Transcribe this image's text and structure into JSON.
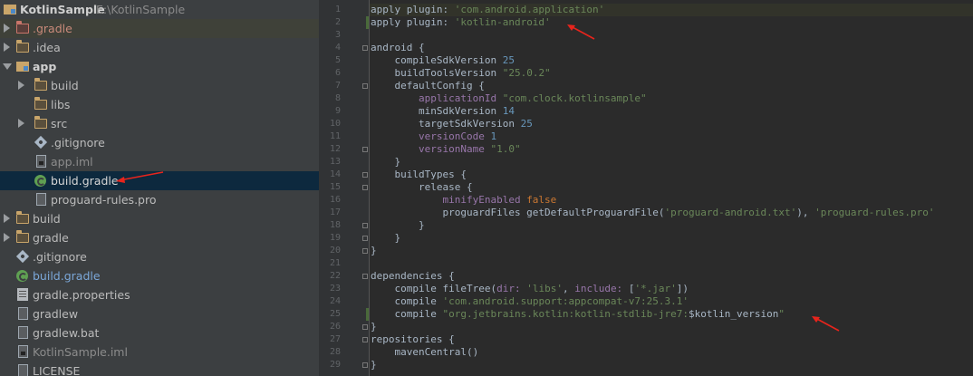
{
  "project_tree": {
    "root": {
      "name": "KotlinSample",
      "path": "E:\\KotlinSample"
    },
    "items": [
      {
        "label": ".gradle"
      },
      {
        "label": ".idea"
      },
      {
        "label": "app"
      },
      {
        "label": "build"
      },
      {
        "label": "libs"
      },
      {
        "label": "src"
      },
      {
        "label": ".gitignore"
      },
      {
        "label": "app.iml"
      },
      {
        "label": "build.gradle"
      },
      {
        "label": "proguard-rules.pro"
      },
      {
        "label": "build"
      },
      {
        "label": "gradle"
      },
      {
        "label": ".gitignore"
      },
      {
        "label": "build.gradle"
      },
      {
        "label": "gradle.properties"
      },
      {
        "label": "gradlew"
      },
      {
        "label": "gradlew.bat"
      },
      {
        "label": "KotlinSample.iml"
      },
      {
        "label": "LICENSE"
      }
    ]
  },
  "editor": {
    "line_numbers": [
      "1",
      "2",
      "3",
      "4",
      "5",
      "6",
      "7",
      "8",
      "9",
      "10",
      "11",
      "12",
      "13",
      "14",
      "15",
      "16",
      "17",
      "18",
      "19",
      "20",
      "21",
      "22",
      "23",
      "24",
      "25",
      "26",
      "27",
      "28",
      "29"
    ],
    "lines": [
      [
        {
          "t": "apply plugin: ",
          "c": "#a9b7c6"
        },
        {
          "t": "'com.android.application'",
          "c": "#6a8759"
        }
      ],
      [
        {
          "t": "apply plugin: ",
          "c": "#a9b7c6"
        },
        {
          "t": "'kotlin-android'",
          "c": "#6a8759"
        }
      ],
      [],
      [
        {
          "t": "android {",
          "c": "#a9b7c6"
        }
      ],
      [
        {
          "t": "    compileSdkVersion ",
          "c": "#a9b7c6"
        },
        {
          "t": "25",
          "c": "#6897bb"
        }
      ],
      [
        {
          "t": "    buildToolsVersion ",
          "c": "#a9b7c6"
        },
        {
          "t": "\"25.0.2\"",
          "c": "#6a8759"
        }
      ],
      [
        {
          "t": "    defaultConfig {",
          "c": "#a9b7c6"
        }
      ],
      [
        {
          "t": "        applicationId ",
          "c": "#9876aa"
        },
        {
          "t": "\"com.clock.kotlinsample\"",
          "c": "#6a8759"
        }
      ],
      [
        {
          "t": "        minSdkVersion ",
          "c": "#a9b7c6"
        },
        {
          "t": "14",
          "c": "#6897bb"
        }
      ],
      [
        {
          "t": "        targetSdkVersion ",
          "c": "#a9b7c6"
        },
        {
          "t": "25",
          "c": "#6897bb"
        }
      ],
      [
        {
          "t": "        versionCode ",
          "c": "#9876aa"
        },
        {
          "t": "1",
          "c": "#6897bb"
        }
      ],
      [
        {
          "t": "        versionName ",
          "c": "#9876aa"
        },
        {
          "t": "\"1.0\"",
          "c": "#6a8759"
        }
      ],
      [
        {
          "t": "    }",
          "c": "#a9b7c6"
        }
      ],
      [
        {
          "t": "    buildTypes {",
          "c": "#a9b7c6"
        }
      ],
      [
        {
          "t": "        release {",
          "c": "#a9b7c6"
        }
      ],
      [
        {
          "t": "            minifyEnabled ",
          "c": "#9876aa"
        },
        {
          "t": "false",
          "c": "#cc7832"
        }
      ],
      [
        {
          "t": "            proguardFiles getDefaultProguardFile(",
          "c": "#a9b7c6"
        },
        {
          "t": "'proguard-android.txt'",
          "c": "#6a8759"
        },
        {
          "t": "), ",
          "c": "#a9b7c6"
        },
        {
          "t": "'proguard-rules.pro'",
          "c": "#6a8759"
        }
      ],
      [
        {
          "t": "        }",
          "c": "#a9b7c6"
        }
      ],
      [
        {
          "t": "    }",
          "c": "#a9b7c6"
        }
      ],
      [
        {
          "t": "}",
          "c": "#a9b7c6"
        }
      ],
      [],
      [
        {
          "t": "dependencies {",
          "c": "#a9b7c6"
        }
      ],
      [
        {
          "t": "    compile fileTree(",
          "c": "#a9b7c6"
        },
        {
          "t": "dir: ",
          "c": "#9876aa"
        },
        {
          "t": "'libs'",
          "c": "#6a8759"
        },
        {
          "t": ", ",
          "c": "#a9b7c6"
        },
        {
          "t": "include: ",
          "c": "#9876aa"
        },
        {
          "t": "[",
          "c": "#a9b7c6"
        },
        {
          "t": "'*.jar'",
          "c": "#6a8759"
        },
        {
          "t": "])",
          "c": "#a9b7c6"
        }
      ],
      [
        {
          "t": "    compile ",
          "c": "#a9b7c6"
        },
        {
          "t": "'com.android.support:appcompat-v7:25.3.1'",
          "c": "#6a8759"
        }
      ],
      [
        {
          "t": "    compile ",
          "c": "#a9b7c6"
        },
        {
          "t": "\"org.jetbrains.kotlin:kotlin-stdlib-jre7:",
          "c": "#6a8759"
        },
        {
          "t": "$kotlin_version",
          "c": "#a9b7c6"
        },
        {
          "t": "\"",
          "c": "#6a8759"
        }
      ],
      [
        {
          "t": "}",
          "c": "#a9b7c6"
        }
      ],
      [
        {
          "t": "repositories {",
          "c": "#a9b7c6"
        }
      ],
      [
        {
          "t": "    mavenCentral()",
          "c": "#a9b7c6"
        }
      ],
      [
        {
          "t": "}",
          "c": "#a9b7c6"
        }
      ]
    ]
  },
  "colors": {
    "annotation_arrow": "#e8241c",
    "selection": "#0d293e"
  }
}
